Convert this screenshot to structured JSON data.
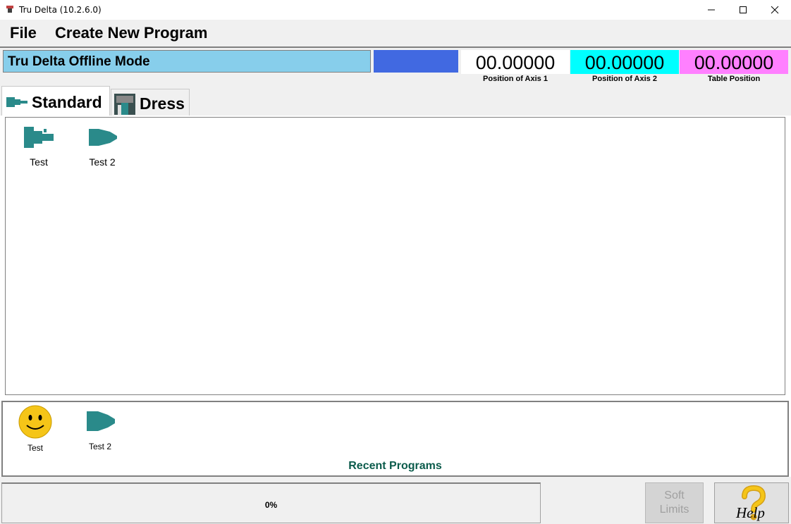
{
  "window": {
    "title": "Tru Delta (10.2.6.0)"
  },
  "menu": {
    "file": "File",
    "create": "Create New Program"
  },
  "status": {
    "mode": "Tru Delta Offline Mode",
    "axis1": {
      "value": "00.00000",
      "label": "Position of Axis 1",
      "color": "#ffffff"
    },
    "axis2": {
      "value": "00.00000",
      "label": "Position of Axis 2",
      "color": "#00ffff"
    },
    "table": {
      "value": "00.00000",
      "label": "Table Position",
      "color": "#ff80ff"
    }
  },
  "tabs": [
    {
      "label": "Standard"
    },
    {
      "label": "Dress"
    }
  ],
  "programs": [
    {
      "label": "Test",
      "icon": "spindle-icon"
    },
    {
      "label": "Test 2",
      "icon": "bowtie-icon"
    }
  ],
  "recent": {
    "title": "Recent Programs",
    "items": [
      {
        "label": "Test",
        "icon": "smiley-icon"
      },
      {
        "label": "Test 2",
        "icon": "bowtie-icon"
      }
    ]
  },
  "bottom": {
    "progress": "0%",
    "soft_limits_line1": "Soft",
    "soft_limits_line2": "Limits",
    "help": "Help"
  }
}
